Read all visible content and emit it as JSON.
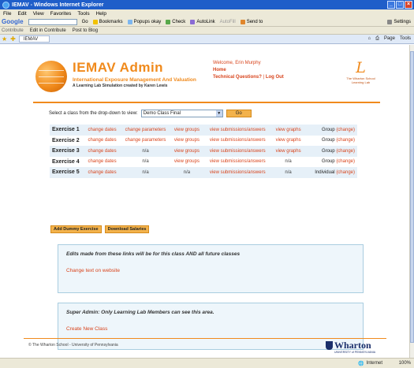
{
  "window": {
    "title": "IEMAV - Windows Internet Explorer",
    "minimize": "_",
    "maximize": "□",
    "close": "×"
  },
  "menu": [
    "File",
    "Edit",
    "View",
    "Favorites",
    "Tools",
    "Help"
  ],
  "google_toolbar": {
    "logo": "Google",
    "go": "Go",
    "bookmarks": "Bookmarks",
    "popups": "Popups okay",
    "check": "Check",
    "autolink": "AutoLink",
    "autofill": "AutoFill",
    "sendto": "Send to",
    "settings": "Settings"
  },
  "contribute_bar": {
    "contribute": "Contribute",
    "edit": "Edit in Contribute",
    "post": "Post to Blog"
  },
  "tab": {
    "label": "IEMAV",
    "page": "Page",
    "tools": "Tools"
  },
  "header": {
    "title": "IEMAV Admin",
    "subtitle": "International Exposure Management And Valuation",
    "credit": "A Learning Lab Simulation created by Karen Lewis",
    "welcome": "Welcome, Erin Murphy",
    "home": "Home",
    "technical": "Technical Questions?",
    "logout": "Log Out",
    "separator": "|",
    "lab_logo_mark": "L",
    "lab_logo_text": "The Wharton School Learning Lab"
  },
  "class_select": {
    "label": "Select a class from the drop-down to view:",
    "value": "Demo Class Final",
    "go": "Go"
  },
  "exercises": [
    {
      "name": "Exercise 1",
      "c1": "change dates",
      "c2": "change parameters",
      "c3": "view groups",
      "c4": "view submissions/answers",
      "c5": "view graphs",
      "mode": "Group",
      "change": "(change)"
    },
    {
      "name": "Exercise 2",
      "c1": "change dates",
      "c2": "change parameters",
      "c3": "view groups",
      "c4": "view submissions/answers",
      "c5": "view graphs",
      "mode": "Group",
      "change": "(change)"
    },
    {
      "name": "Exercise 3",
      "c1": "change dates",
      "c2": "n/a",
      "c3": "view groups",
      "c4": "view submissions/answers",
      "c5": "view graphs",
      "mode": "Group",
      "change": "(change)"
    },
    {
      "name": "Exercise 4",
      "c1": "change dates",
      "c2": "n/a",
      "c3": "view groups",
      "c4": "view submissions/answers",
      "c5": "n/a",
      "mode": "Group",
      "change": "(change)"
    },
    {
      "name": "Exercise 5",
      "c1": "change dates",
      "c2": "n/a",
      "c3": "n/a",
      "c4": "view submissions/answers",
      "c5": "n/a",
      "mode": "Individual",
      "change": "(change)"
    }
  ],
  "buttons": {
    "add_dummy": "Add Dummy Exercise",
    "download": "Download Salaries"
  },
  "panel1": {
    "title": "Edits made from these links will be for this class AND all future classes",
    "link": "Change text on website"
  },
  "panel2": {
    "title": "Super Admin: Only Learning Lab Members can see this area.",
    "link": "Create New Class"
  },
  "footer": {
    "text": "© The Wharton School - University of Pennsylvania",
    "wharton": "Wharton",
    "wharton_sub": "UNIVERSITY of PENNSYLVANIA"
  },
  "status": {
    "zone": "Internet",
    "zoom": "100%"
  }
}
